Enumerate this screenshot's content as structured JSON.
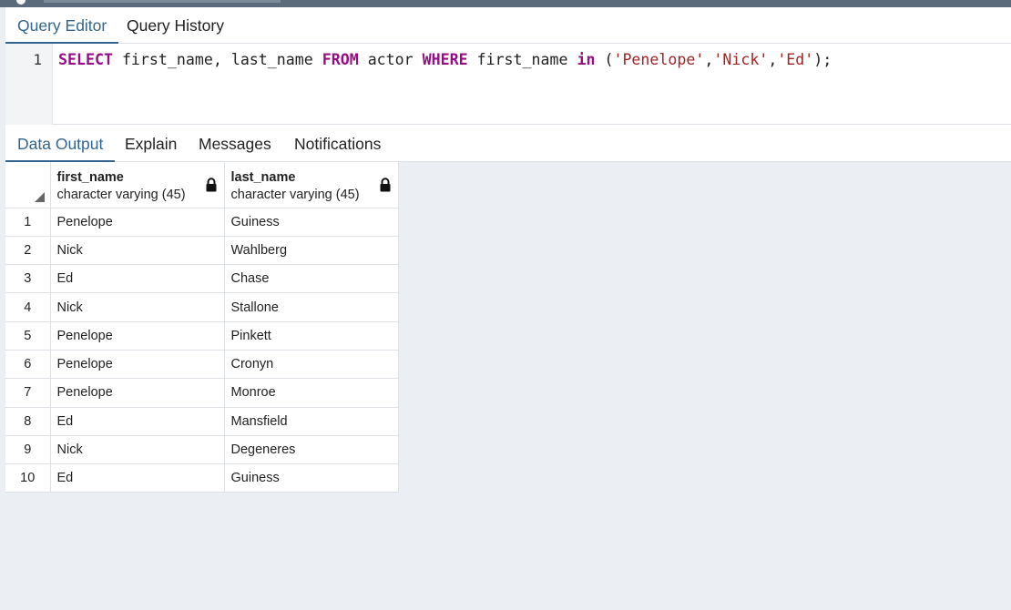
{
  "query_tabs": [
    {
      "label": "Query Editor",
      "active": true
    },
    {
      "label": "Query History",
      "active": false
    }
  ],
  "editor": {
    "line_number": "1",
    "tokens": [
      {
        "t": "SELECT",
        "k": "kw"
      },
      {
        "t": " first_name, last_name ",
        "k": "pn"
      },
      {
        "t": "FROM",
        "k": "kw"
      },
      {
        "t": " actor ",
        "k": "pn"
      },
      {
        "t": "WHERE",
        "k": "kw"
      },
      {
        "t": " first_name ",
        "k": "pn"
      },
      {
        "t": "in",
        "k": "kw"
      },
      {
        "t": " (",
        "k": "pn"
      },
      {
        "t": "'Penelope'",
        "k": "str"
      },
      {
        "t": ",",
        "k": "pn"
      },
      {
        "t": "'Nick'",
        "k": "str"
      },
      {
        "t": ",",
        "k": "pn"
      },
      {
        "t": "'Ed'",
        "k": "str"
      },
      {
        "t": ");",
        "k": "pn"
      }
    ]
  },
  "output_tabs": [
    {
      "label": "Data Output",
      "active": true
    },
    {
      "label": "Explain",
      "active": false
    },
    {
      "label": "Messages",
      "active": false
    },
    {
      "label": "Notifications",
      "active": false
    }
  ],
  "columns": [
    {
      "name": "first_name",
      "type": "character varying (45)",
      "icon": "lock-icon"
    },
    {
      "name": "last_name",
      "type": "character varying (45)",
      "icon": "lock-icon"
    }
  ],
  "rows": [
    [
      "1",
      "Penelope",
      "Guiness"
    ],
    [
      "2",
      "Nick",
      "Wahlberg"
    ],
    [
      "3",
      "Ed",
      "Chase"
    ],
    [
      "4",
      "Nick",
      "Stallone"
    ],
    [
      "5",
      "Penelope",
      "Pinkett"
    ],
    [
      "6",
      "Penelope",
      "Cronyn"
    ],
    [
      "7",
      "Penelope",
      "Monroe"
    ],
    [
      "8",
      "Ed",
      "Mansfield"
    ],
    [
      "9",
      "Nick",
      "Degeneres"
    ],
    [
      "10",
      "Ed",
      "Guiness"
    ]
  ],
  "colors": {
    "accent": "#326690",
    "keyword": "#990d84",
    "string": "#a52222",
    "panel_bg": "#ebeef2"
  }
}
